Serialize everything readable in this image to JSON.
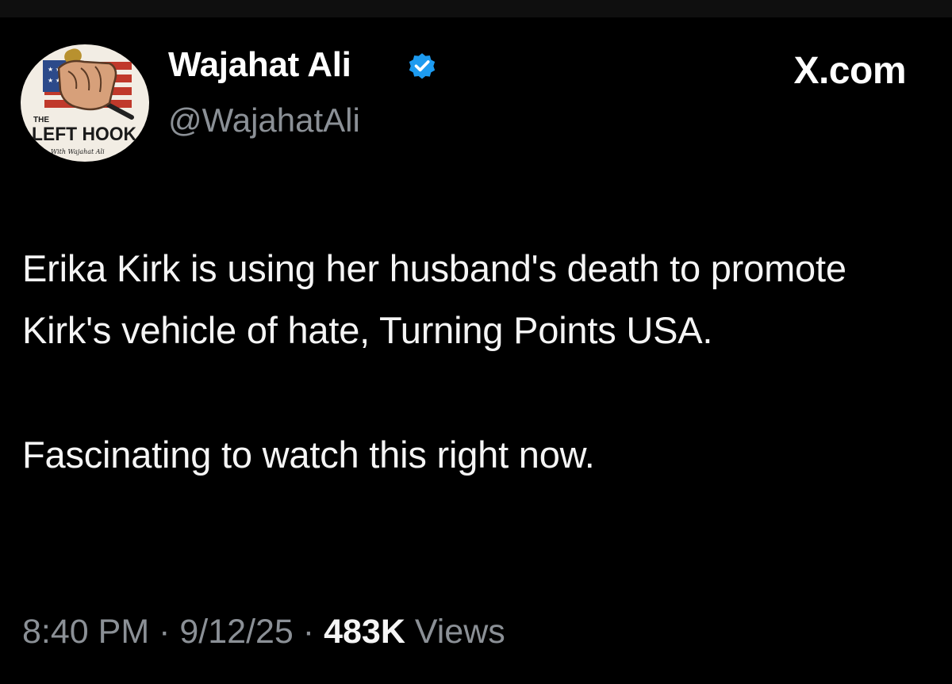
{
  "header": {
    "display_name": "Wajahat Ali",
    "handle": "@WajahatAli",
    "brand": "X.com",
    "verified_color": "#1d9bf0",
    "verified_icon": "verified-badge-icon"
  },
  "avatar": {
    "logo_text_top": "THE",
    "logo_text_main": "LEFT HOOK",
    "logo_text_sub": "With Wajahat Ali"
  },
  "tweet": {
    "paragraphs": [
      "Erika Kirk is using her husband's death to promote Kirk's vehicle of hate, Turning Points USA.",
      "Fascinating to watch this right now."
    ]
  },
  "meta": {
    "time": "8:40 PM",
    "separator": "·",
    "date": "9/12/25",
    "views_count": "483K",
    "views_label": "Views"
  }
}
